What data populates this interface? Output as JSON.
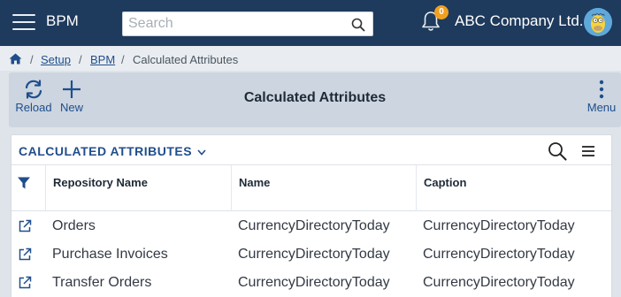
{
  "app": {
    "name": "BPM"
  },
  "search": {
    "placeholder": "Search"
  },
  "notifications": {
    "count": "0"
  },
  "company": {
    "name": "ABC Company Ltd."
  },
  "breadcrumb": {
    "items": [
      {
        "label": "Setup"
      },
      {
        "label": "BPM"
      },
      {
        "label": "Calculated Attributes"
      }
    ],
    "separator": "/"
  },
  "toolbar": {
    "reload_label": "Reload",
    "new_label": "New",
    "title": "Calculated Attributes",
    "menu_label": "Menu"
  },
  "panel": {
    "title": "CALCULATED ATTRIBUTES"
  },
  "table": {
    "columns": [
      "Repository Name",
      "Name",
      "Caption"
    ],
    "rows": [
      {
        "repository": "Orders",
        "name": "CurrencyDirectoryToday",
        "caption": "CurrencyDirectoryToday"
      },
      {
        "repository": "Purchase Invoices",
        "name": "CurrencyDirectoryToday",
        "caption": "CurrencyDirectoryToday"
      },
      {
        "repository": "Transfer Orders",
        "name": "CurrencyDirectoryToday",
        "caption": "CurrencyDirectoryToday"
      }
    ]
  },
  "colors": {
    "topbar": "#1e3a5c",
    "accent": "#1f4e8c",
    "badge": "#f0a020",
    "toolbar": "#ccd5e0"
  },
  "icons": [
    "menu-icon",
    "search-icon",
    "bell-icon",
    "avatar",
    "home-icon",
    "reload-icon",
    "plus-icon",
    "more-vertical-icon",
    "chevron-down-icon",
    "list-menu-icon",
    "filter-icon",
    "external-link-icon"
  ]
}
